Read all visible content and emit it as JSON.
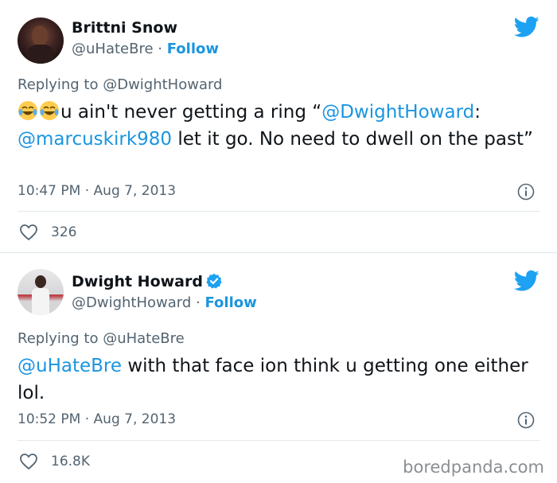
{
  "tweets": [
    {
      "author_name": "Brittni Snow",
      "handle": "@uHateBre",
      "separator": " · ",
      "follow_label": "Follow",
      "verified": false,
      "replying_prefix": "Replying to ",
      "replying_to": "@DwightHoward",
      "text_emoji": "joy-emoji x2",
      "text_part1": "u ain't never getting a ring “",
      "text_mention1": "@DwightHoward",
      "text_part2": ":",
      "text_mention2": "@marcuskirk980",
      "text_part3": " let it go. No need to dwell on the past”",
      "time": "10:47 PM",
      "date": "Aug 7, 2013",
      "likes": "326"
    },
    {
      "author_name": "Dwight Howard",
      "handle": "@DwightHoward",
      "separator": " · ",
      "follow_label": "Follow",
      "verified": true,
      "replying_prefix": "Replying to ",
      "replying_to": "@uHateBre",
      "text_mention1": "@uHateBre",
      "text_part1": " with that face ion think u getting one either lol.",
      "time": "10:52 PM",
      "date": "Aug 7, 2013",
      "likes": "16.8K"
    }
  ],
  "watermark": "boredpanda.com",
  "colors": {
    "link": "#1b95e0",
    "secondary_text": "#536471",
    "divider": "#e1e8ed",
    "twitter_blue": "#1da1f2"
  },
  "icons": [
    "twitter-bird-icon",
    "verified-badge-icon",
    "info-icon",
    "heart-icon",
    "joy-emoji"
  ]
}
